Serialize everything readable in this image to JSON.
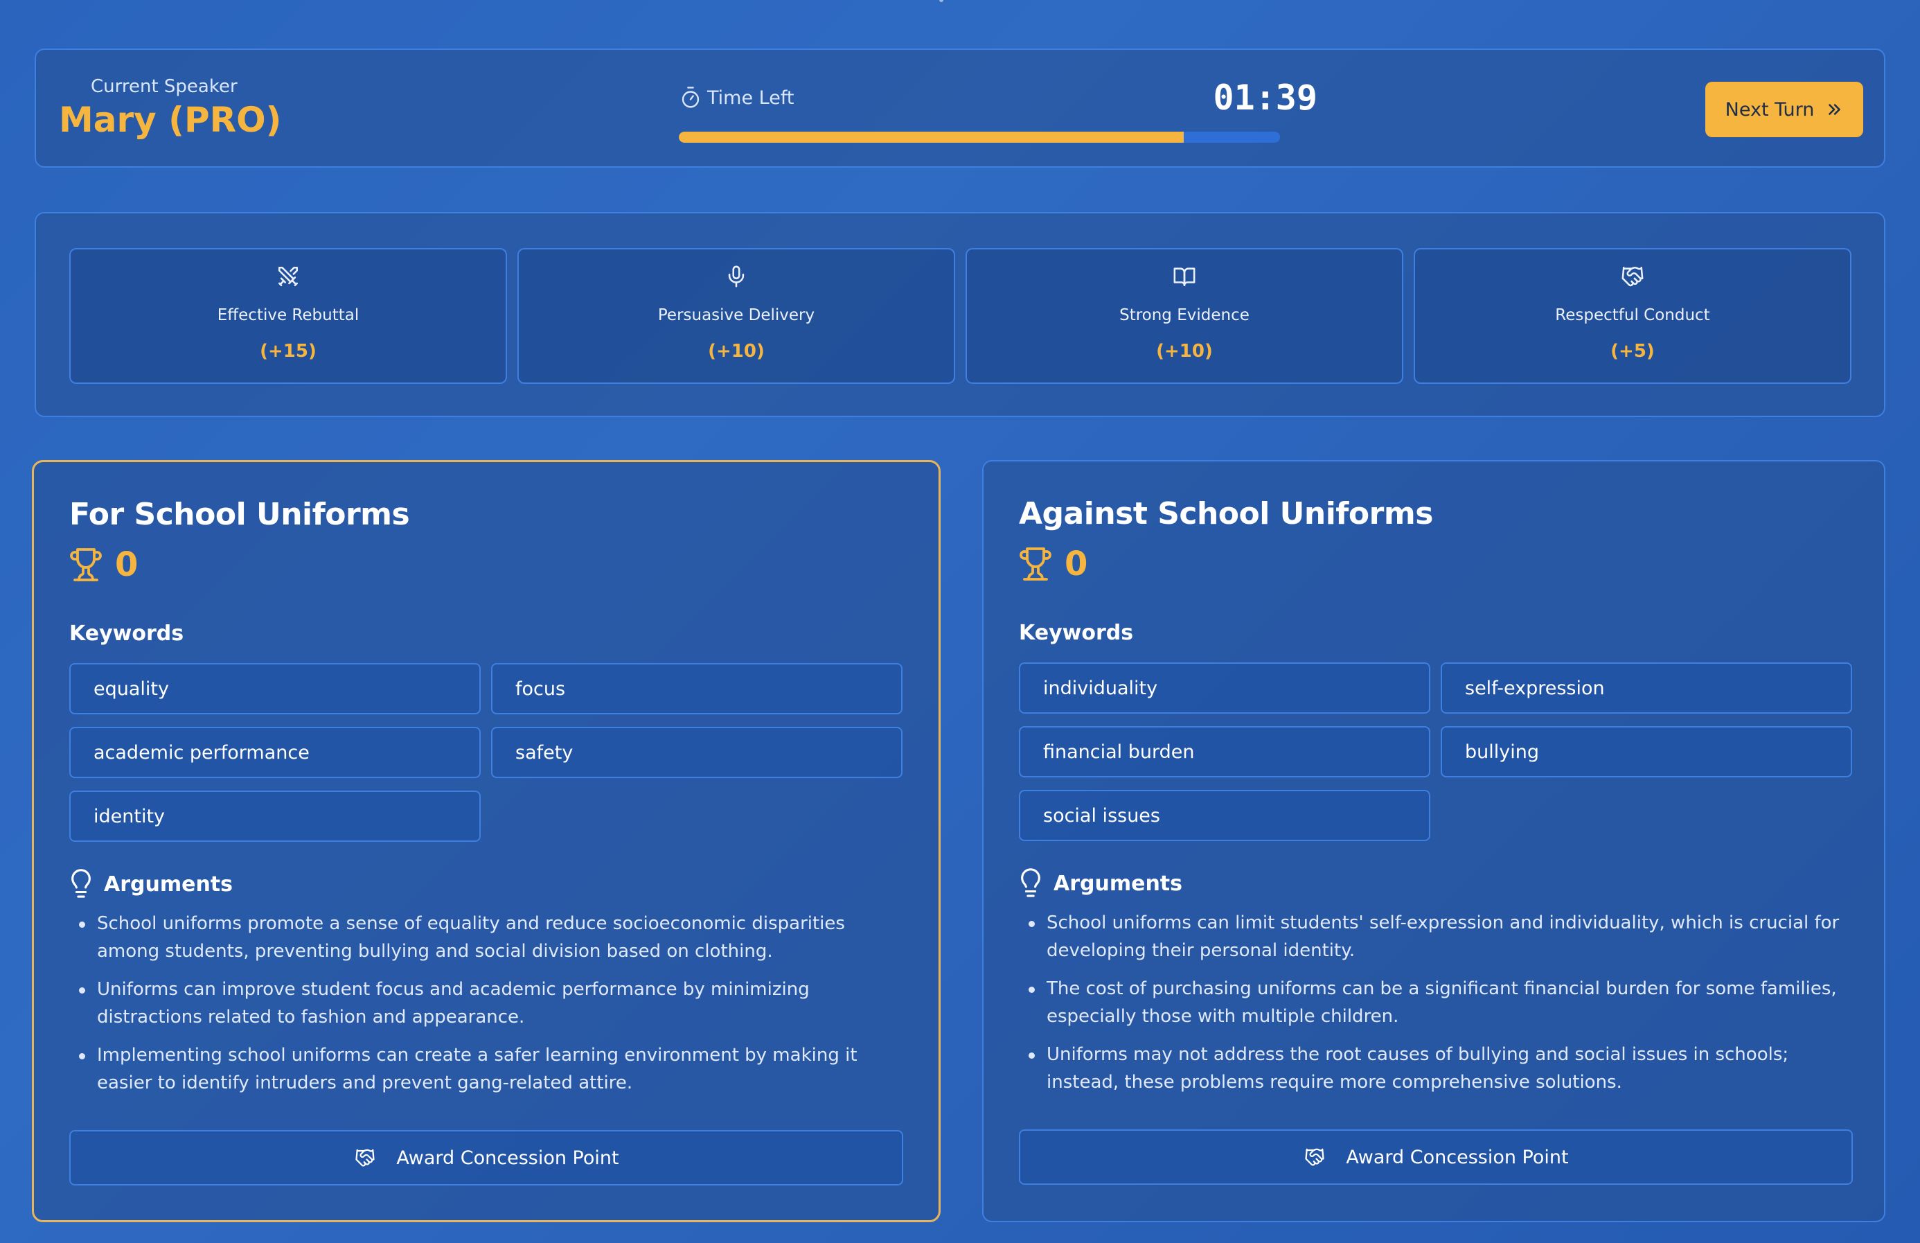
{
  "header": {
    "speaker_label": "Current Speaker",
    "speaker_name": "Mary (PRO)",
    "timer_label": "Time Left",
    "timer_value": "01:39",
    "time_progress_percent": 84,
    "next_label": "Next Turn",
    "icons": {
      "timer": "stopwatch-icon",
      "next": "chevrons-right-icon"
    }
  },
  "awards": [
    {
      "name": "Effective Rebuttal",
      "points": "(+15)",
      "icon": "swords-icon"
    },
    {
      "name": "Persuasive Delivery",
      "points": "(+10)",
      "icon": "microphone-icon"
    },
    {
      "name": "Strong Evidence",
      "points": "(+10)",
      "icon": "book-open-icon"
    },
    {
      "name": "Respectful Conduct",
      "points": "(+5)",
      "icon": "handshake-icon"
    }
  ],
  "teams": {
    "pro": {
      "title": "For School Uniforms",
      "score": "0",
      "keywords_heading": "Keywords",
      "keywords": [
        "equality",
        "focus",
        "academic performance",
        "safety",
        "identity"
      ],
      "arguments_heading": "Arguments",
      "arguments": [
        "School uniforms promote a sense of equality and reduce socioeconomic disparities among students, preventing bullying and social division based on clothing.",
        "Uniforms can improve student focus and academic performance by minimizing distractions related to fashion and appearance.",
        "Implementing school uniforms can create a safer learning environment by making it easier to identify intruders and prevent gang-related attire."
      ],
      "concede_label": "Award Concession Point",
      "active": true
    },
    "con": {
      "title": "Against School Uniforms",
      "score": "0",
      "keywords_heading": "Keywords",
      "keywords": [
        "individuality",
        "self-expression",
        "financial burden",
        "bullying",
        "social issues"
      ],
      "arguments_heading": "Arguments",
      "arguments": [
        "School uniforms can limit students' self-expression and individuality, which is crucial for developing their personal identity.",
        "The cost of purchasing uniforms can be a significant financial burden for some families, especially those with multiple children.",
        "Uniforms may not address the root causes of bullying and social issues in schools; instead, these problems require more comprehensive solutions."
      ],
      "concede_label": "Award Concession Point",
      "active": false
    }
  },
  "colors": {
    "accent": "#f5b53f",
    "border": "#3f7fe0",
    "background": "#2a64bd"
  }
}
